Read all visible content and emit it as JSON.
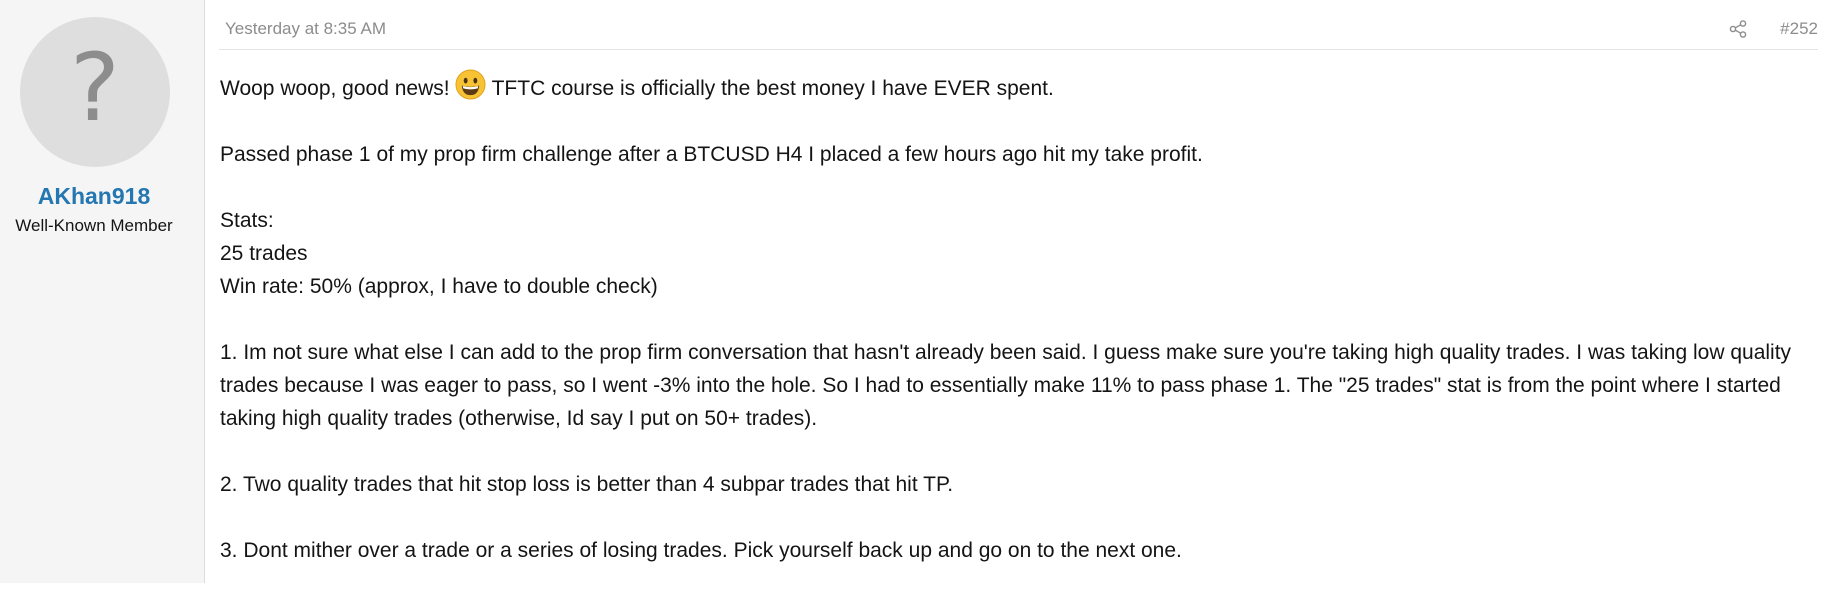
{
  "user": {
    "avatar_glyph": "?",
    "name": "AKhan918",
    "title": "Well-Known Member"
  },
  "post": {
    "timestamp": "Yesterday at 8:35 AM",
    "number": "#252",
    "line1_before_emoji": "Woop woop, good news!",
    "line1_after_emoji": "TFTC course is officially the best money I have EVER spent.",
    "para2": "Passed phase 1 of my prop firm challenge after a BTCUSD H4 I placed a few hours ago hit my take profit.",
    "stats_label": "Stats:",
    "stats_trades": "25 trades",
    "stats_winrate": "Win rate: 50% (approx, I have to double check)",
    "point1": "1. Im not sure what else I can add to the prop firm conversation that hasn't already been said. I guess make sure you're taking high quality trades. I was taking low quality trades because I was eager to pass, so I went -3% into the hole. So I had to essentially make 11% to pass phase 1. The \"25 trades\" stat is from the point where I started taking high quality trades (otherwise, Id say I put on 50+ trades).",
    "point2": "2. Two quality trades that hit stop loss is better than 4 subpar trades that hit TP.",
    "point3": "3. Dont mither over a trade or a series of losing trades. Pick yourself back up and go on to the next one."
  },
  "icons": {
    "avatar": "question-mark-placeholder",
    "share": "share-icon",
    "emoji": "grinning-face-emoji"
  },
  "colors": {
    "username": "#2577b1",
    "muted": "#8c8c8c",
    "sidebar_bg": "#f5f5f5",
    "emoji_yellow": "#f7c234"
  }
}
